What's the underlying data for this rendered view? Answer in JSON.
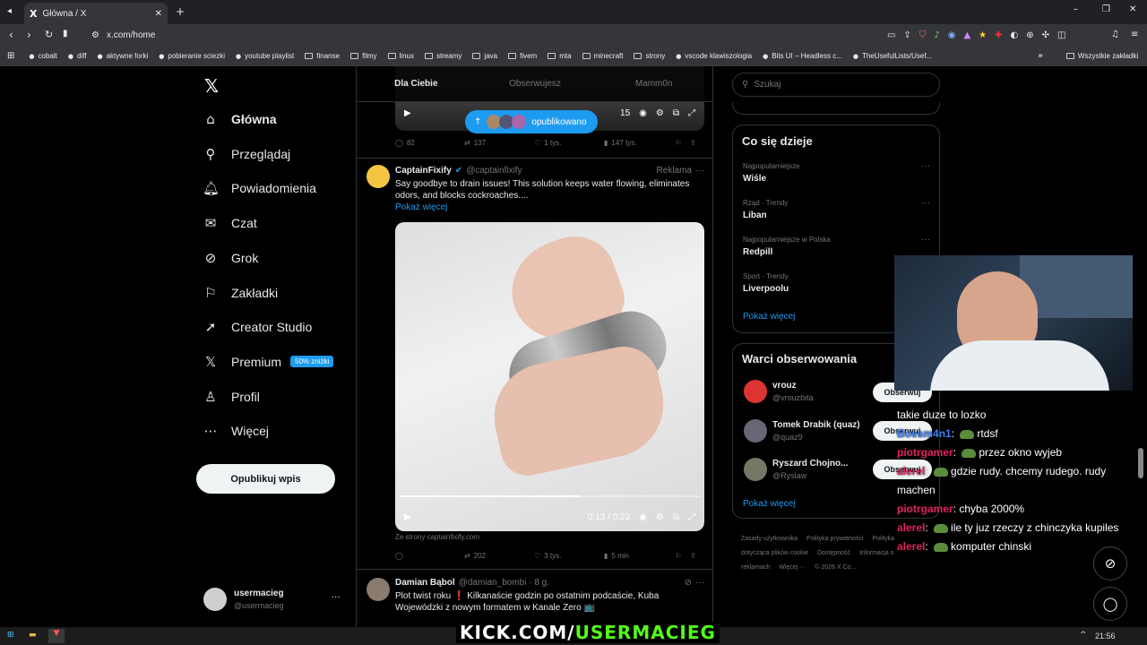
{
  "browser": {
    "tab_title": "Główna / X",
    "url": "x.com/home",
    "bookmarks": [
      "cobalt",
      "diff",
      "aktywne forki",
      "pobieranie sciezki",
      "youtube playlist",
      "finanse",
      "filmy",
      "linux",
      "streamy",
      "java",
      "fivem",
      "mta",
      "minecraft",
      "strony",
      "vscode klawiszologia",
      "Bits UI – Headless c...",
      "TheUsefulLists/Usef..."
    ],
    "all_bookmarks": "Wszystkie zakładki"
  },
  "nav": {
    "items": [
      "Główna",
      "Przeglądaj",
      "Powiadomienia",
      "Czat",
      "Grok",
      "Zakładki",
      "Creator Studio",
      "Premium",
      "Profil",
      "Więcej"
    ],
    "premium_badge": "50% zniżki",
    "publish": "Opublikuj wpis",
    "user_name": "usermacieg",
    "user_handle": "@usermacieg"
  },
  "feed": {
    "tabs": [
      "Dla Ciebie",
      "Obserwujesz",
      "Mamm0n"
    ],
    "new_posts_label": "opublikowano",
    "top_video_time": "15",
    "top_stats": {
      "replies": "82",
      "reposts": "137",
      "likes": "1 tys.",
      "views": "147 tys."
    },
    "ad": {
      "name": "CaptainFixify",
      "handle": "@captainfixify",
      "label": "Reklama",
      "text": "Say goodbye to drain issues! This solution keeps water flowing, eliminates odors, and blocks cockroaches....",
      "more": "Pokaż więcej",
      "time": "0:13 / 0:22",
      "source": "Ze strony captainfixify.com",
      "stats": {
        "reposts": "202",
        "likes": "3 tys.",
        "views": "5 min"
      },
      "video_progress": 0.6
    },
    "post": {
      "name": "Damian Bąbol",
      "handle": "@damian_bombi · 8 g.",
      "text": "Plot twist roku ❗ Kilkanaście godzin po ostatnim podcaście, Kuba Wojewódzki z nowym formatem w Kanale Zero 📺"
    }
  },
  "right": {
    "search_placeholder": "Szukaj",
    "trends_title": "Co się dzieje",
    "trends": [
      {
        "meta": "Najpopularniejsze",
        "name": "Wiśle"
      },
      {
        "meta": "Rząd · Trendy",
        "name": "Liban"
      },
      {
        "meta": "Najpopularniejsze w Polska",
        "name": "Redpill"
      },
      {
        "meta": "Sport · Trendy",
        "name": "Liverpoolu"
      }
    ],
    "show_more": "Pokaż więcej",
    "who_title": "Warci obserwowania",
    "who": [
      {
        "name": "vrouz",
        "handle": "@vrouzbita"
      },
      {
        "name": "Tomek Drabik (quaz)",
        "handle": "@quaz9"
      },
      {
        "name": "Ryszard Chojno...",
        "handle": "@Ryslaw"
      }
    ],
    "follow_label": "Obserwuj",
    "footer": [
      "Zasady użytkownika",
      "Polityka prywatności",
      "Polityka dotycząca plików cookie",
      "Dostępność",
      "Informacja o reklamach",
      "Więcej ···",
      "© 2026 X Co..."
    ]
  },
  "chat": [
    {
      "user": "",
      "text": "takie duze to lozko"
    },
    {
      "user": "Boesm4n1",
      "text": "rtdsf",
      "frog": true,
      "style": "u2"
    },
    {
      "user": "piotrgamer",
      "text": "przez okno wyjeb",
      "frog": true,
      "style": "u1"
    },
    {
      "user": "alerel",
      "text": "gdzie rudy. chcemy rudego. rudy machen",
      "frog": true,
      "style": "u1"
    },
    {
      "user": "piotrgamer",
      "text": "chyba 2000%",
      "frog": false,
      "style": "u1"
    },
    {
      "user": "alerel",
      "text": "ile ty juz rzeczy z chinczyka kupiles",
      "frog": true,
      "style": "u1"
    },
    {
      "user": "alerel",
      "text": "komputer chinski",
      "frog": true,
      "style": "u1"
    }
  ],
  "overlay": {
    "kick_prefix": "KICK.COM/",
    "kick_user": "USERMACIEG"
  },
  "taskbar": {
    "time": "21:56"
  },
  "colors": {
    "accent": "#1d9bf0",
    "kick": "#53fc18"
  }
}
